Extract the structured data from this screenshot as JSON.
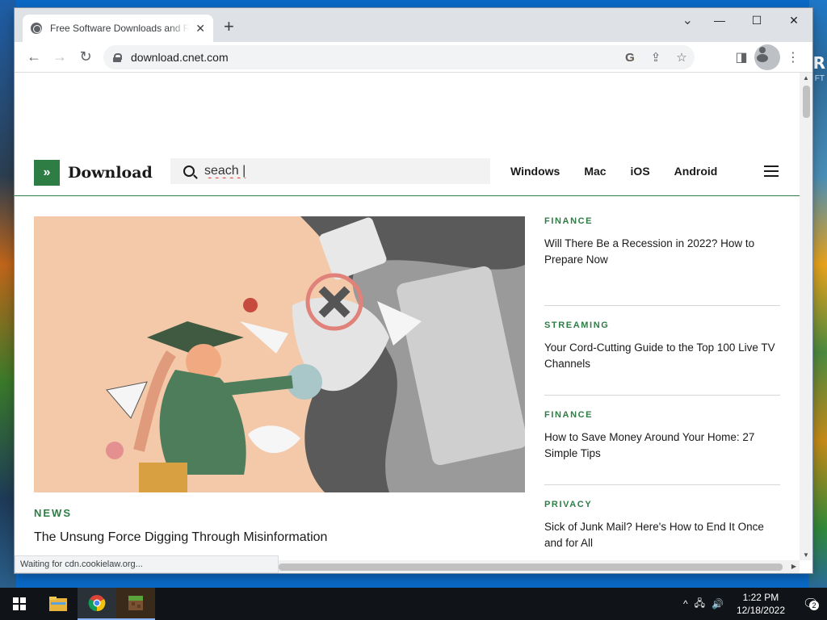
{
  "browser": {
    "tab_title": "Free Software Downloads and Reviews",
    "url": "download.cnet.com",
    "status_text": "Waiting for cdn.cookielaw.org...",
    "icons": [
      "back-icon",
      "forward-icon",
      "reload-icon",
      "lock-icon",
      "google-icon",
      "share-icon",
      "star-icon",
      "side-panel-icon",
      "profile-icon",
      "menu-icon"
    ]
  },
  "site": {
    "logo_mark": "»",
    "logo_text": "Download",
    "search_value": "seach |",
    "nav": [
      "Windows",
      "Mac",
      "iOS",
      "Android"
    ],
    "brand_color": "#2e7d45"
  },
  "hero": {
    "category": "NEWS",
    "title": "The Unsung Force Digging Through Misinformation"
  },
  "side_articles": [
    {
      "category": "FINANCE",
      "title": "Will There Be a Recession in 2022? How to Prepare Now"
    },
    {
      "category": "STREAMING",
      "title": "Your Cord-Cutting Guide to the Top 100 Live TV Channels"
    },
    {
      "category": "FINANCE",
      "title": "How to Save Money Around Your Home: 27 Simple Tips"
    },
    {
      "category": "PRIVACY",
      "title": "Sick of Junk Mail? Here's How to End It Once and for All"
    }
  ],
  "desktop": {
    "right_edge_text": "R",
    "right_edge_subtext": "FT"
  },
  "taskbar": {
    "time": "1:22 PM",
    "date": "12/18/2022",
    "notification_count": "2",
    "apps": [
      "file-explorer-icon",
      "chrome-icon",
      "minecraft-icon"
    ]
  }
}
